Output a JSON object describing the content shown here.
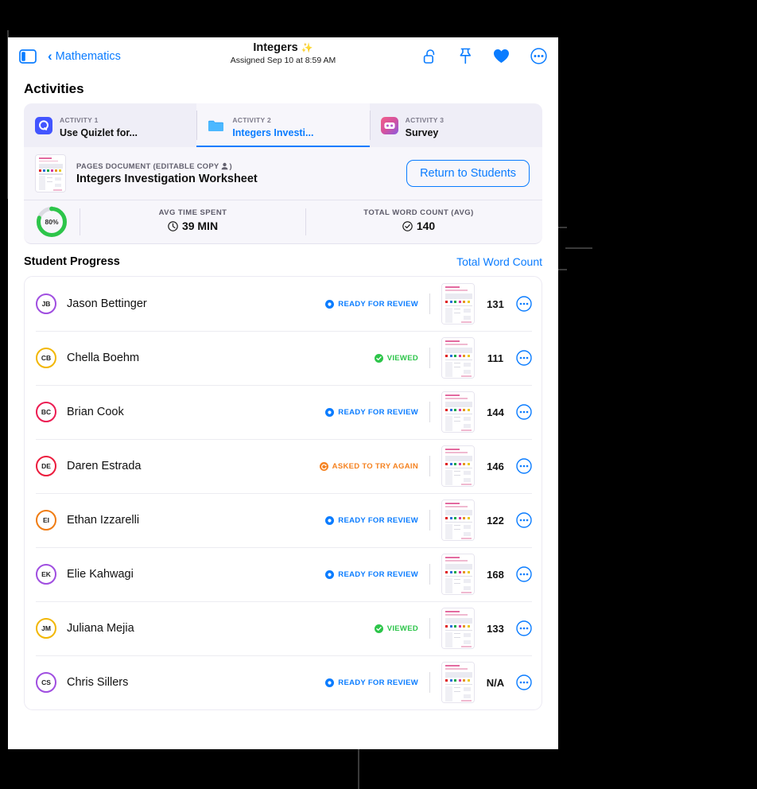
{
  "colors": {
    "accent": "#0a7cff",
    "green": "#2dc54a",
    "orange": "#f58220",
    "panel_bg": "#f7f6fb",
    "tabs_bg": "#efeef7"
  },
  "navbar": {
    "sidebar_icon": "sidebar-toggle-icon",
    "back_chevron": "‹",
    "back_label": "Mathematics",
    "title": "Integers",
    "title_emoji": "✨",
    "subtitle": "Assigned Sep 10 at 8:59 AM",
    "icons": [
      "unlock-icon",
      "pin-icon",
      "heart-icon",
      "more-icon"
    ]
  },
  "activities": {
    "section_title": "Activities",
    "tabs": [
      {
        "kicker": "ACTIVITY 1",
        "name": "Use Quizlet for...",
        "icon": "quizlet-app-icon",
        "active": false
      },
      {
        "kicker": "ACTIVITY 2",
        "name": "Integers Investi...",
        "icon": "folder-icon",
        "active": true
      },
      {
        "kicker": "ACTIVITY 3",
        "name": "Survey",
        "icon": "survey-app-icon",
        "active": false
      }
    ]
  },
  "document": {
    "kicker": "PAGES DOCUMENT (EDITABLE COPY",
    "kicker_icon": "person-icon",
    "kicker_close": ")",
    "name": "Integers Investigation Worksheet",
    "return_button": "Return to Students"
  },
  "stats": {
    "ring_percent": "80%",
    "ring_value": 80,
    "items": [
      {
        "label": "AVG TIME SPENT",
        "value": "39 MIN",
        "icon": "clock-icon"
      },
      {
        "label": "TOTAL WORD COUNT (AVG)",
        "value": "140",
        "icon": "checkmark-seal-icon"
      }
    ]
  },
  "student_progress": {
    "title": "Student Progress",
    "link": "Total Word Count",
    "statuses": {
      "ready": {
        "label": "READY FOR REVIEW",
        "color": "#0a7cff",
        "icon": "ready-for-review-icon"
      },
      "viewed": {
        "label": "VIEWED",
        "color": "#2dc54a",
        "icon": "viewed-check-icon"
      },
      "retry": {
        "label": "ASKED TO TRY AGAIN",
        "color": "#f58220",
        "icon": "try-again-icon"
      }
    },
    "rows": [
      {
        "initials": "JB",
        "name": "Jason Bettinger",
        "avatar_color": "#a04ee0",
        "status": "ready",
        "word_count": "131"
      },
      {
        "initials": "CB",
        "name": "Chella Boehm",
        "avatar_color": "#f2b705",
        "status": "viewed",
        "word_count": "111"
      },
      {
        "initials": "BC",
        "name": "Brian Cook",
        "avatar_color": "#ec1c52",
        "status": "ready",
        "word_count": "144"
      },
      {
        "initials": "DE",
        "name": "Daren Estrada",
        "avatar_color": "#ec1c3d",
        "status": "retry",
        "word_count": "146"
      },
      {
        "initials": "EI",
        "name": "Ethan Izzarelli",
        "avatar_color": "#f07c13",
        "status": "ready",
        "word_count": "122"
      },
      {
        "initials": "EK",
        "name": "Elie Kahwagi",
        "avatar_color": "#a04ee0",
        "status": "ready",
        "word_count": "168"
      },
      {
        "initials": "JM",
        "name": "Juliana Mejia",
        "avatar_color": "#f2b705",
        "status": "viewed",
        "word_count": "133"
      },
      {
        "initials": "CS",
        "name": "Chris Sillers",
        "avatar_color": "#a04ee0",
        "status": "ready",
        "word_count": "N/A"
      }
    ]
  }
}
